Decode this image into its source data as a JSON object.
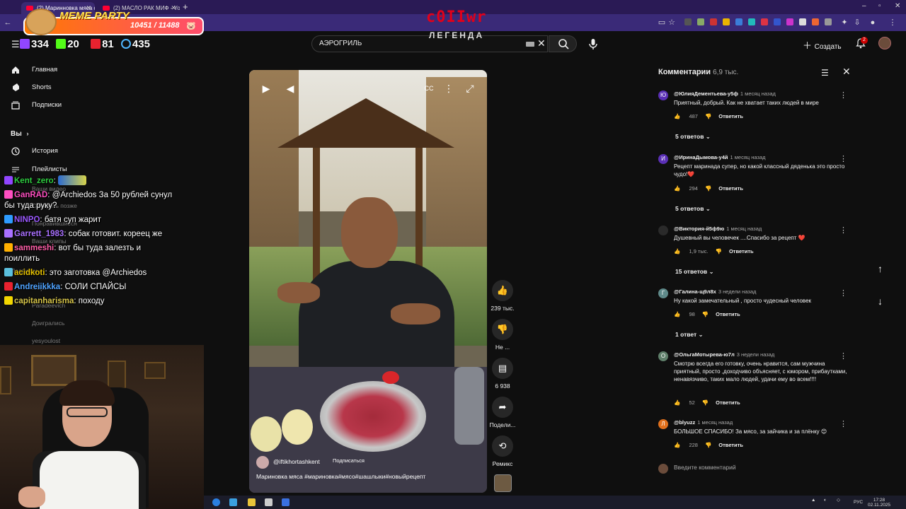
{
  "browser": {
    "tabs": [
      {
        "label": "(2) Маринновка мяса #марин",
        "active": true
      },
      {
        "label": "(2) МАСЛО РАК МИФ - YouTube",
        "active": false
      }
    ]
  },
  "overlay": {
    "alert_title": "MEME PARTY",
    "alert_count": "10451 / 11488",
    "stats": {
      "viewers": "334",
      "kick": "20",
      "live": "81",
      "followers": "435"
    },
    "brand": "c0IIwr",
    "brand_sub": "ЛЕГЕНДА"
  },
  "header": {
    "search_value": "АЭРОГРИЛЬ",
    "create_label": "Создать",
    "notif_count": "2"
  },
  "sidebar": {
    "items": [
      {
        "label": "Главная",
        "icon": "home-icon"
      },
      {
        "label": "Shorts",
        "icon": "shorts-icon"
      },
      {
        "label": "Подписки",
        "icon": "subscriptions-icon"
      }
    ],
    "you_label": "Вы",
    "you_items": [
      {
        "label": "История",
        "icon": "history-icon"
      },
      {
        "label": "Плейлисты",
        "icon": "playlists-icon"
      }
    ],
    "ghost": [
      "Ваши видео",
      "Смотреть позже",
      "Понравившиеся",
      "Ваши клипы",
      "Подписки",
      "Ninja",
      "Paradeevich",
      "Доигрались",
      "yesyoulost"
    ]
  },
  "chat": [
    {
      "user": "Kent_zero",
      "color": "#2ecc40",
      "text": "",
      "emote": true
    },
    {
      "user": "GanRAD",
      "color": "#ff4fc1",
      "text": "@Archiedos За 50 рублей сунул бы туда руку?"
    },
    {
      "user": "NINPO",
      "color": "#9b59ff",
      "text": "батя суп жарит"
    },
    {
      "user": "Garrett_1983",
      "color": "#a970ff",
      "text": "собак готовит. кореец же"
    },
    {
      "user": "sammeshi",
      "color": "#ff5ea8",
      "text": "вот бы туда залезть и поиллить"
    },
    {
      "user": "acidkoti",
      "color": "#e8c300",
      "text": "это заготовка @Archiedos"
    },
    {
      "user": "Andreiikkka",
      "color": "#4fa3ff",
      "text": "СОЛИ СПАЙСЫ"
    },
    {
      "user": "capitanharisma",
      "color": "#d7c54a",
      "text": "походу"
    }
  ],
  "player": {
    "channel": "@iftikhortashkent",
    "subscribe_label": "Подписаться",
    "caption": "Мариновка мяса #мариновка#мясо#шашлыки#новыйрецепт"
  },
  "actions": [
    {
      "icon": "like-icon",
      "label": "239 тыс."
    },
    {
      "icon": "dislike-icon",
      "label": "Не ..."
    },
    {
      "icon": "comment-icon",
      "label": "6 938"
    },
    {
      "icon": "share-icon",
      "label": "Подели..."
    },
    {
      "icon": "remix-icon",
      "label": "Ремикс"
    }
  ],
  "comments": {
    "title": "Комментарии",
    "count": "6,9 тыс.",
    "input_placeholder": "Введите комментарий",
    "items": [
      {
        "avatar": "Ю",
        "avatar_color": "#5a2fb5",
        "user": "@ЮлияДементьева-у5ф",
        "time": "1 месяц назад",
        "text": "Приятный, добрый. Как не хватает таких людей в мире",
        "likes": "487",
        "replies": "5 ответов"
      },
      {
        "avatar": "И",
        "avatar_color": "#5a2fb5",
        "user": "@ИринаДымова-у4й",
        "time": "1 месяц назад",
        "text": "Рецепт маринада супер, но какой классный дяденька это просто чудо!❤️",
        "likes": "294",
        "replies": "5 ответов"
      },
      {
        "avatar": "",
        "avatar_color": "#2a2a2a",
        "user": "@Виктория-й5ф9ю",
        "time": "1 месяц назад",
        "text": "Душевный вы человечек ....Спасибо за рецепт ❤️",
        "likes": "1,9 тыс.",
        "replies": "15 ответов"
      },
      {
        "avatar": "Г",
        "avatar_color": "#5f8a8a",
        "user": "@Галина-щ9л8х",
        "time": "3 недели назад",
        "text": "Ну какой замечательный , просто чудесный человек",
        "likes": "98",
        "replies": "1 ответ"
      },
      {
        "avatar": "О",
        "avatar_color": "#5f7f6a",
        "user": "@ОльгаМотырева-ю7л",
        "time": "3 недели назад",
        "text": "Смотрю всегда его готовку, очень нравится, сам мужчина приятный, просто ,доходчиво объясняет, с юмором, прибаутками, ненавязчиво, таких мало людей, удачи ему во всем!!!!",
        "likes": "52",
        "replies": ""
      },
      {
        "avatar": "Л",
        "avatar_color": "#e0701c",
        "user": "@blyuzz",
        "time": "1 месяц назад",
        "text": "БОЛЬШОЕ СПАСИБО!  За мясо, за зайчика и за плёнку 😊",
        "likes": "228",
        "replies": ""
      }
    ],
    "reply_label": "Ответить"
  },
  "taskbar": {
    "lang": "РУС",
    "time": "17:28",
    "date": "02.11.2025"
  }
}
